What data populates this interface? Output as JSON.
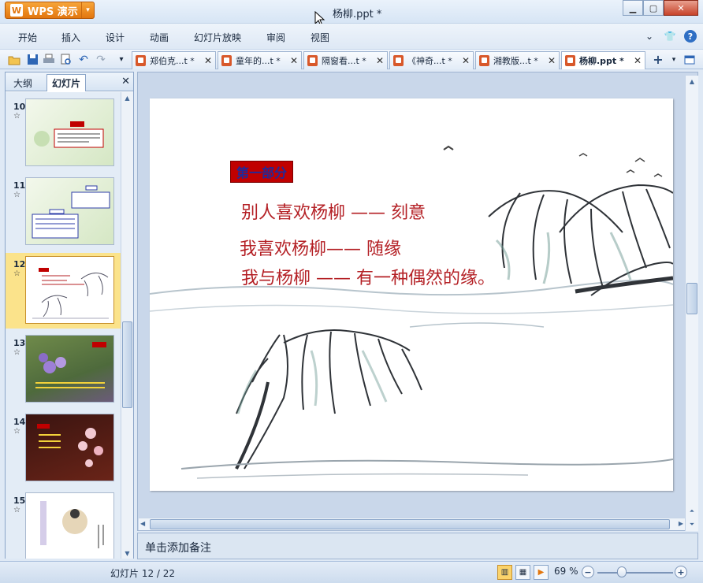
{
  "app": {
    "name": "WPS 演示",
    "logo": "W"
  },
  "window": {
    "title": "杨柳.ppt *",
    "controls": [
      "minimize",
      "maximize",
      "close"
    ]
  },
  "menu": {
    "items": [
      "开始",
      "插入",
      "设计",
      "动画",
      "幻灯片放映",
      "审阅",
      "视图"
    ],
    "right_icons": [
      "chevron-down-icon",
      "shirt-icon",
      "help-icon"
    ]
  },
  "toolbar": {
    "icons": [
      "open-folder-icon",
      "save-icon",
      "print-icon",
      "print-preview-icon",
      "undo-icon",
      "redo-icon",
      "dropdown-icon"
    ]
  },
  "doc_tabs": [
    {
      "label": "郑伯克...t *",
      "active": false
    },
    {
      "label": "童年的...t *",
      "active": false
    },
    {
      "label": "隔窗看...t *",
      "active": false
    },
    {
      "label": "《神奇...t *",
      "active": false
    },
    {
      "label": "湘教版...t *",
      "active": false
    },
    {
      "label": "杨柳.ppt *",
      "active": true
    }
  ],
  "left_pane": {
    "tabs": [
      "大纲",
      "幻灯片"
    ],
    "active_tab": "幻灯片",
    "thumbnails": [
      {
        "number": "10",
        "star": "☆",
        "selected": false
      },
      {
        "number": "11",
        "star": "☆",
        "selected": false
      },
      {
        "number": "12",
        "star": "☆",
        "selected": true
      },
      {
        "number": "13",
        "star": "☆",
        "selected": false
      },
      {
        "number": "14",
        "star": "☆",
        "selected": false
      },
      {
        "number": "15",
        "star": "☆",
        "selected": false
      }
    ]
  },
  "slide": {
    "badge": "第一部分",
    "lines": [
      "别人喜欢杨柳 —— 刻意",
      "我喜欢杨柳—— 随缘",
      "我与杨柳 —— 有一种偶然的缘。"
    ],
    "text_color": "#b42025",
    "badge_bg": "#c00000",
    "badge_text_color": "#1f2a9c"
  },
  "notes": {
    "placeholder": "单击添加备注"
  },
  "status": {
    "slide_count": "幻灯片 12 / 22",
    "zoom": "69 %",
    "views": [
      "normal-view-icon",
      "slide-sorter-icon",
      "slideshow-icon"
    ]
  }
}
